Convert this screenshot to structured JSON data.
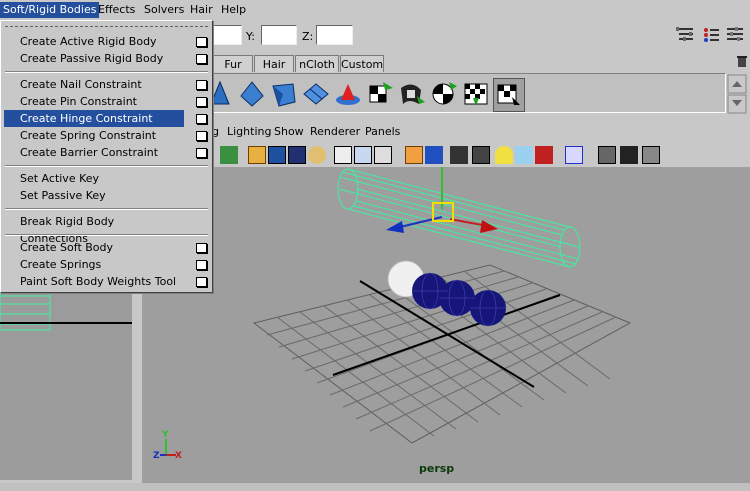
{
  "menubar": {
    "items": [
      "Soft/Rigid Bodies",
      "Effects",
      "Solvers",
      "Hair",
      "Help"
    ],
    "active": "Soft/Rigid Bodies"
  },
  "status_line": {
    "y_label": "Y:",
    "z_label": "Z:",
    "x_value": "",
    "y_value": "",
    "z_value": ""
  },
  "shelf": {
    "tabs": [
      "Fur",
      "Hair",
      "nCloth",
      "Custom"
    ],
    "icons": [
      "active-rigid-icon",
      "passive-rigid-icon",
      "nail-constraint-icon",
      "pin-constraint-icon",
      "hinge-constraint-icon",
      "spring-constraint-icon",
      "barrier-constraint-icon",
      "soft-body-icon",
      "springs-icon",
      "gravity-field-icon",
      "newton-field-icon",
      "selected-tool-icon"
    ]
  },
  "panel_menu": {
    "items": [
      "g",
      "Lighting",
      "Show",
      "Renderer",
      "Panels"
    ]
  },
  "dropdown": {
    "groups": [
      [
        {
          "label": "Create Active Rigid Body",
          "option_box": true
        },
        {
          "label": "Create Passive Rigid Body",
          "option_box": true
        }
      ],
      [
        {
          "label": "Create Nail Constraint",
          "option_box": true
        },
        {
          "label": "Create Pin Constraint",
          "option_box": true
        },
        {
          "label": "Create Hinge Constraint",
          "option_box": true,
          "highlighted": true
        },
        {
          "label": "Create Spring Constraint",
          "option_box": true
        },
        {
          "label": "Create Barrier Constraint",
          "option_box": true
        }
      ],
      [
        {
          "label": "Set Active Key",
          "option_box": false
        },
        {
          "label": "Set Passive Key",
          "option_box": false
        }
      ],
      [
        {
          "label": "Break Rigid Body Connections",
          "option_box": false
        }
      ],
      [
        {
          "label": "Create Soft Body",
          "option_box": true
        },
        {
          "label": "Create Springs",
          "option_box": true
        },
        {
          "label": "Paint Soft Body Weights Tool",
          "option_box": true
        }
      ]
    ]
  },
  "viewport": {
    "camera_label": "persp",
    "axis": {
      "y": "Y",
      "z": "Z",
      "x": "X"
    }
  },
  "colors": {
    "highlight": "#244f9e",
    "wire_selected": "#3cf0a0",
    "sphere_blue": "#1a1a80",
    "sphere_white": "#ffffff",
    "viewport_bg": "#9e9e9e"
  }
}
